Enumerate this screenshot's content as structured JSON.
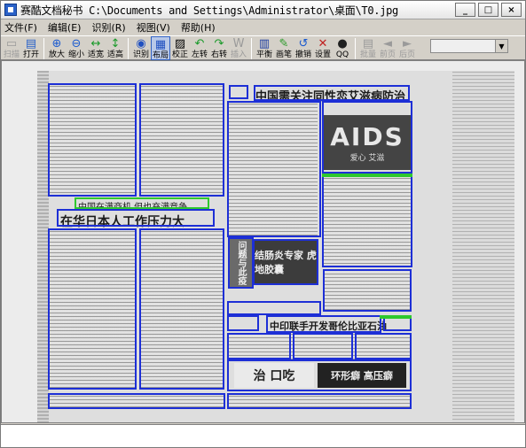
{
  "window": {
    "title": "赛酷文档秘书 C:\\Documents and Settings\\Administrator\\桌面\\T0.jpg",
    "controls": [
      "_",
      "□",
      "×"
    ]
  },
  "menu": [
    "文件(F)",
    "编辑(E)",
    "识别(R)",
    "视图(V)",
    "帮助(H)"
  ],
  "toolbar": [
    {
      "label": "扫描",
      "icon": "scanner-icon",
      "disabled": true
    },
    {
      "label": "打开",
      "icon": "open-folder-icon"
    },
    {
      "label": "放大",
      "icon": "zoom-in-icon"
    },
    {
      "label": "缩小",
      "icon": "zoom-out-icon"
    },
    {
      "label": "适宽",
      "icon": "fit-width-icon"
    },
    {
      "label": "适高",
      "icon": "fit-height-icon"
    },
    {
      "label": "识别",
      "icon": "recognize-icon"
    },
    {
      "label": "布局",
      "icon": "layout-icon",
      "active": true
    },
    {
      "label": "校正",
      "icon": "deskew-icon"
    },
    {
      "label": "左转",
      "icon": "rotate-left-icon"
    },
    {
      "label": "右转",
      "icon": "rotate-right-icon"
    },
    {
      "label": "插入",
      "icon": "insert-icon",
      "disabled": true
    },
    {
      "label": "平衡",
      "icon": "balance-icon"
    },
    {
      "label": "画笔",
      "icon": "pen-icon"
    },
    {
      "label": "撤销",
      "icon": "undo-icon"
    },
    {
      "label": "设置",
      "icon": "settings-icon"
    },
    {
      "label": "QQ",
      "icon": "qq-icon"
    },
    {
      "label": "批量",
      "icon": "batch-icon",
      "disabled": true
    },
    {
      "label": "前页",
      "icon": "prev-page-icon",
      "disabled": true
    },
    {
      "label": "后页",
      "icon": "next-page-icon",
      "disabled": true
    }
  ],
  "page_combo": {
    "value": ""
  },
  "document": {
    "headline_1": "中国需关注同性恋艾滋病防治",
    "headline_2": "在华日本人工作压力大",
    "subhead_1": "中国在满商机 但也充满竞争",
    "subhead_2": "中印联手开发哥伦比亚石油",
    "aids_word": "AIDS",
    "aids_sub": "爱心  艾滋",
    "ad_1": "问题与此疫",
    "ad_2": "结肠炎专家 虎地胶囊",
    "ad_3": "治 口吃",
    "ad_4": "环形癖 高压癖"
  },
  "colors": {
    "region_border": "#1d2fd6",
    "selected_region": "#2ec82e"
  }
}
